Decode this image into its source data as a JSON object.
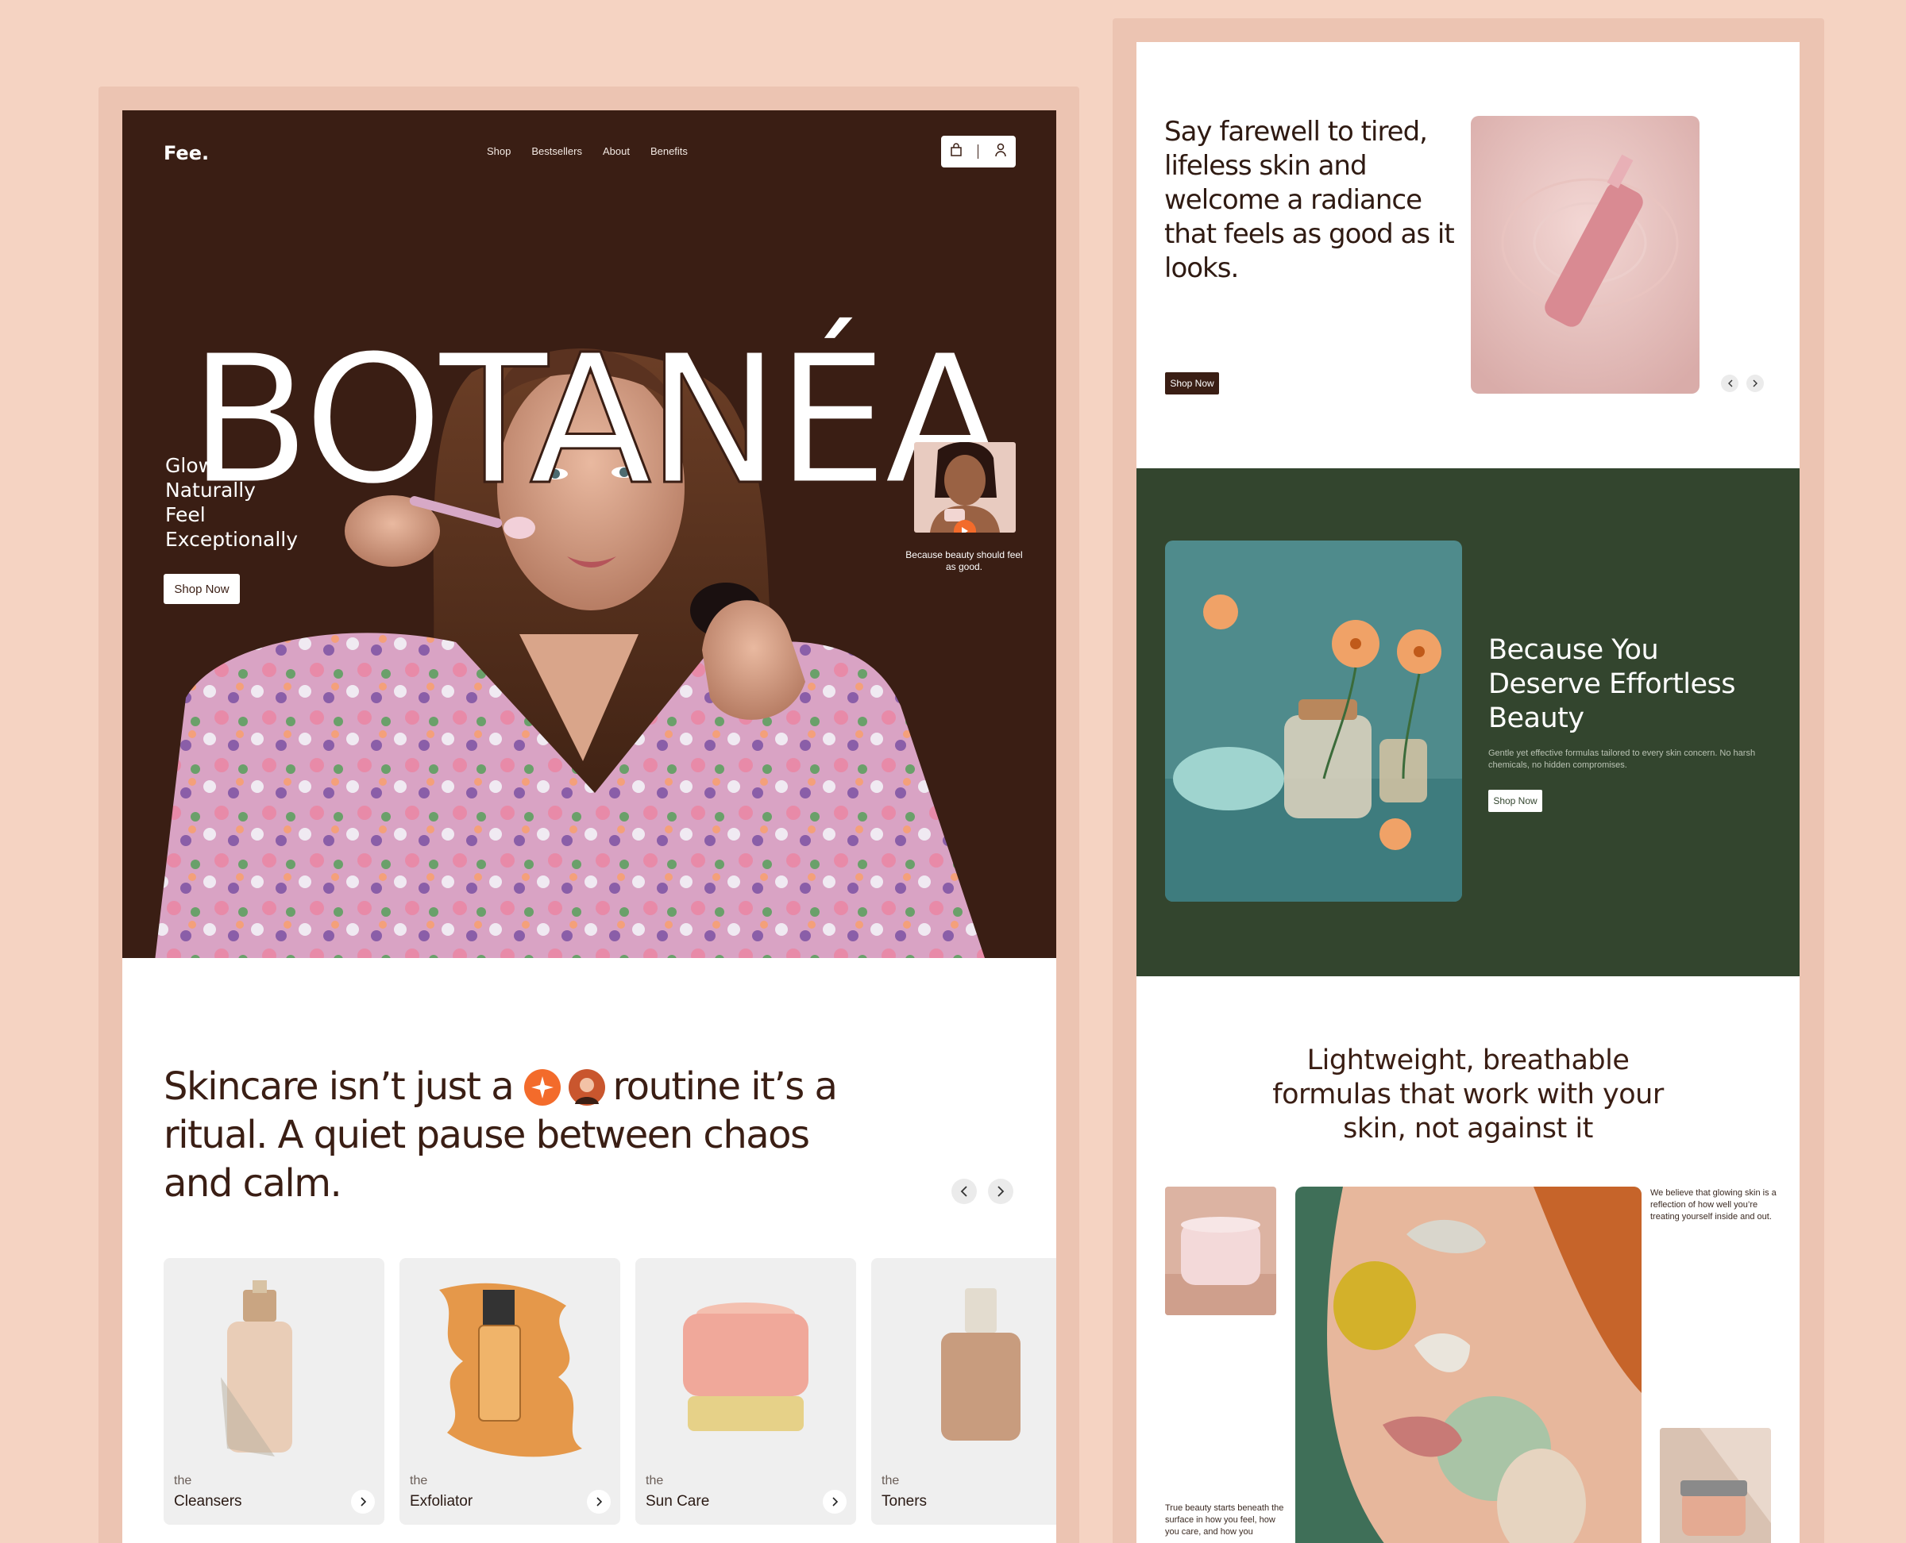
{
  "header": {
    "logo": "Fee.",
    "nav": [
      "Shop",
      "Bestsellers",
      "About",
      "Benefits"
    ],
    "icons": [
      "bag-icon",
      "user-icon"
    ]
  },
  "hero": {
    "brand": "BOTANÉA",
    "tagline": [
      "Glow",
      "Naturally",
      "Feel",
      "Exceptionally"
    ],
    "cta": "Shop Now",
    "video_caption": "Because beauty should feel as good."
  },
  "intro": {
    "part1": "Skincare isn’t just a",
    "part2": "routine it’s a ritual. A quiet pause between chaos and calm."
  },
  "categories": [
    {
      "prefix": "the",
      "name": "Cleansers"
    },
    {
      "prefix": "the",
      "name": "Exfoliator"
    },
    {
      "prefix": "the",
      "name": "Sun Care"
    },
    {
      "prefix": "the",
      "name": "Toners"
    }
  ],
  "right": {
    "farewell": "Say farewell to tired, lifeless skin and welcome a radiance that feels as good as it looks.",
    "cta_dark": "Shop Now",
    "green_title": "Because You Deserve Effortless Beauty",
    "green_sub": "Gentle yet effective formulas tailored to every skin concern. No harsh chemicals, no hidden compromises.",
    "cta_light": "Shop Now",
    "light_title": "Lightweight, breathable formulas that work with your skin, not against it",
    "believe": "We believe that glowing skin is a reflection of how well you’re treating yourself inside and out.",
    "true_beauty": "True beauty starts beneath the surface in how you feel, how you care, and how you"
  },
  "colors": {
    "background": "#f5d3c2",
    "hero_brown": "#3a1e14",
    "forest_green": "#33452e",
    "accent_orange": "#f36b2b"
  }
}
